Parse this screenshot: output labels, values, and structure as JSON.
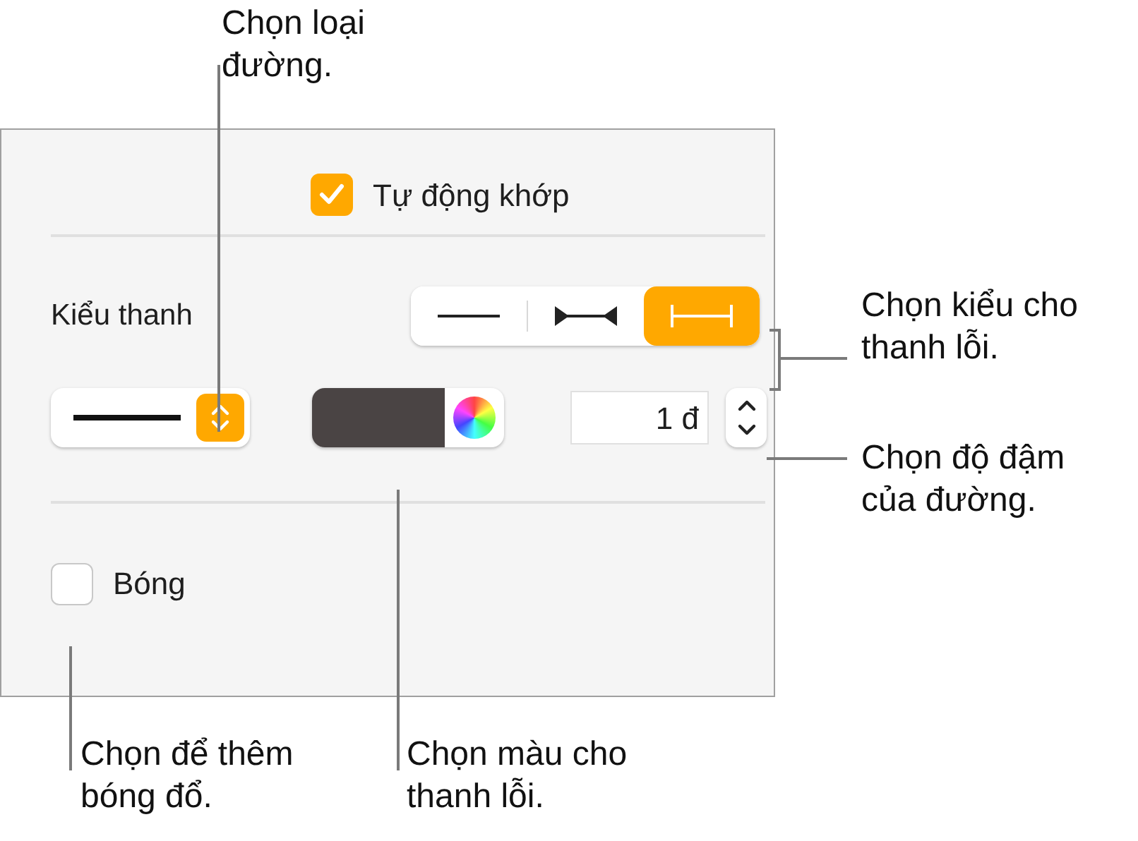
{
  "callouts": [
    {
      "kind": "top",
      "text": "Chọn loại\nđường."
    },
    {
      "kind": "bar_style",
      "text": "Chọn kiểu cho\nthanh lỗi."
    },
    {
      "kind": "weight",
      "text": "Chọn độ đậm\ncủa đường."
    },
    {
      "kind": "shadow",
      "text": "Chọn để thêm\nbóng đổ."
    },
    {
      "kind": "color",
      "text": "Chọn màu cho\nthanh lỗi."
    }
  ],
  "panel": {
    "auto_fit": {
      "label": "Tự động khớp",
      "checked": true
    },
    "bar_style": {
      "label": "Kiểu thanh",
      "segments": [
        {
          "kind": "plain",
          "selected": false
        },
        {
          "kind": "inward",
          "selected": false
        },
        {
          "kind": "capped",
          "selected": true
        }
      ]
    },
    "color_well": {
      "color": "#4a4444"
    },
    "weight": {
      "value": "1 đ"
    },
    "shadow": {
      "label": "Bóng",
      "checked": false
    }
  }
}
